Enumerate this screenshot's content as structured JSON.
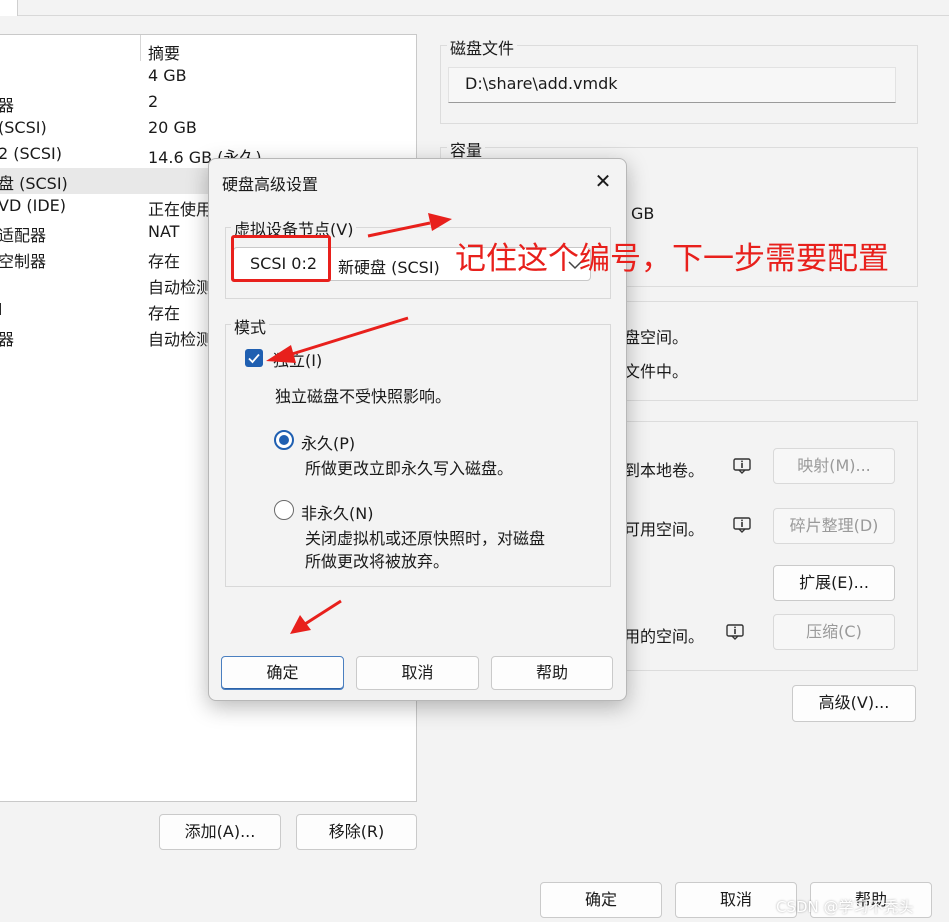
{
  "device_list": {
    "header_summary": "摘要",
    "rows": [
      {
        "device": "",
        "summary": "4 GB"
      },
      {
        "device": "器",
        "summary": "2"
      },
      {
        "device": "(SCSI)",
        "summary": "20 GB"
      },
      {
        "device": "2 (SCSI)",
        "summary": "14.6 GB (永久)"
      },
      {
        "device": "盘 (SCSI)",
        "summary": ""
      },
      {
        "device": "VD (IDE)",
        "summary": "正在使用"
      },
      {
        "device": "适配器",
        "summary": "NAT"
      },
      {
        "device": "空制器",
        "summary": "存在"
      },
      {
        "device": "",
        "summary": "自动检测"
      },
      {
        "device": "l",
        "summary": "存在"
      },
      {
        "device": "器",
        "summary": "自动检测"
      }
    ],
    "add_button": "添加(A)...",
    "remove_button": "移除(R)"
  },
  "disk_file": {
    "label": "磁盘文件",
    "value": "D:\\share\\add.vmdk"
  },
  "capacity": {
    "label": "容量",
    "value": "GB"
  },
  "info_panel": {
    "line1": "盘空间。",
    "line2": "文件中。"
  },
  "utilities": {
    "map_text": "到本地卷。",
    "map_button": "映射(M)...",
    "defrag_text": "可用空间。",
    "defrag_button": "碎片整理(D)",
    "expand_button": "扩展(E)...",
    "compact_text": "用的空间。",
    "compact_button": "压缩(C)"
  },
  "advanced_button": "高级(V)...",
  "bottom_buttons": {
    "ok": "确定",
    "cancel": "取消",
    "help": "帮助"
  },
  "dialog": {
    "title": "硬盘高级设置",
    "close_glyph": "✕",
    "node_group_label": "虚拟设备节点(V)",
    "node_value": "SCSI 0:2",
    "node_description": "新硬盘 (SCSI)",
    "mode_group_label": "模式",
    "independent_label": "独立(I)",
    "independent_desc": "独立磁盘不受快照影响。",
    "persistent_label": "永久(P)",
    "persistent_desc": "所做更改立即永久写入磁盘。",
    "nonpersistent_label": "非永久(N)",
    "nonpersistent_desc1": "关闭虚拟机或还原快照时，对磁盘",
    "nonpersistent_desc2": "所做更改将被放弃。",
    "ok": "确定",
    "cancel": "取消",
    "help": "帮助"
  },
  "annotation": {
    "text": "记住这个编号，下一步需要配置",
    "color": "#e8201c"
  },
  "watermark": "CSDN @学习不秃头",
  "colors": {
    "accent": "#1f5fb1",
    "annotation_red": "#e8201c"
  }
}
